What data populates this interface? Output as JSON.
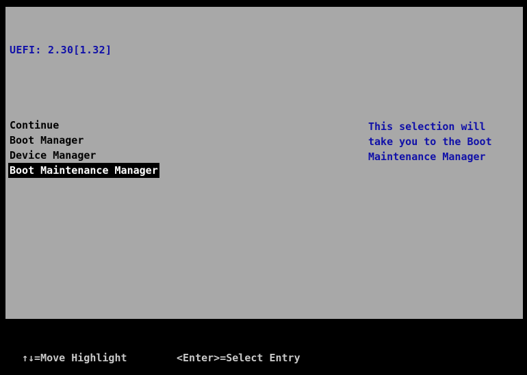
{
  "header": {
    "firmware_version": "UEFI: 2.30[1.32]"
  },
  "menu": {
    "items": [
      {
        "label": "Continue",
        "selected": false
      },
      {
        "label": "Boot Manager",
        "selected": false
      },
      {
        "label": "Device Manager",
        "selected": false
      },
      {
        "label": "Boot Maintenance Manager",
        "selected": true
      }
    ]
  },
  "help": {
    "lines": [
      "This selection will",
      "take you to the Boot",
      "Maintenance Manager"
    ]
  },
  "footer": {
    "move_hint": "↑↓=Move Highlight",
    "select_hint": "<Enter>=Select Entry"
  },
  "colors": {
    "background": "#a8a8a8",
    "menu_text": "#000000",
    "highlight_bg": "#000000",
    "highlight_text": "#ffffff",
    "info_text": "#1010a8",
    "footer_bg": "#000000",
    "footer_text": "#c8c8c8"
  }
}
